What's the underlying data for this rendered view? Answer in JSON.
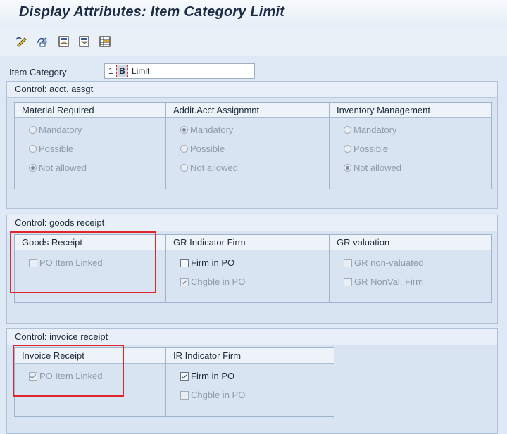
{
  "window": {
    "title": "Display Attributes: Item Category Limit"
  },
  "toolbar": {
    "buttons": [
      {
        "icon": "edit-pencil-icon"
      },
      {
        "icon": "other-object-icon"
      },
      {
        "icon": "previous-entry-icon"
      },
      {
        "icon": "next-entry-icon"
      },
      {
        "icon": "table-view-icon"
      }
    ]
  },
  "item_category": {
    "label": "Item Category",
    "code_1": "1",
    "code_2": "B",
    "description": "Limit"
  },
  "acct_assgt": {
    "title": "Control: acct. assgt",
    "groups": [
      {
        "header": "Material Required",
        "options": [
          {
            "label": "Mandatory",
            "selected": false
          },
          {
            "label": "Possible",
            "selected": false
          },
          {
            "label": "Not allowed",
            "selected": true
          }
        ]
      },
      {
        "header": "Addit.Acct Assignmnt",
        "options": [
          {
            "label": "Mandatory",
            "selected": true
          },
          {
            "label": "Possible",
            "selected": false
          },
          {
            "label": "Not allowed",
            "selected": false
          }
        ]
      },
      {
        "header": "Inventory Management",
        "options": [
          {
            "label": "Mandatory",
            "selected": false
          },
          {
            "label": "Possible",
            "selected": false
          },
          {
            "label": "Not allowed",
            "selected": true
          }
        ]
      }
    ]
  },
  "goods_receipt": {
    "title": "Control: goods receipt",
    "groups": [
      {
        "header": "Goods Receipt",
        "options": [
          {
            "label": "PO Item Linked",
            "checked": false
          }
        ]
      },
      {
        "header": "GR Indicator Firm",
        "options": [
          {
            "label": "Firm in PO",
            "checked": false
          },
          {
            "label": "Chgble in PO",
            "checked": true
          }
        ]
      },
      {
        "header": "GR valuation",
        "options": [
          {
            "label": "GR non-valuated",
            "checked": false
          },
          {
            "label": "GR NonVal. Firm",
            "checked": false
          }
        ]
      }
    ]
  },
  "invoice_receipt": {
    "title": "Control: invoice receipt",
    "groups": [
      {
        "header": "Invoice Receipt",
        "options": [
          {
            "label": "PO Item Linked",
            "checked": true
          }
        ]
      },
      {
        "header": "IR Indicator Firm",
        "options": [
          {
            "label": "Firm in PO",
            "checked": true
          },
          {
            "label": "Chgble in PO",
            "checked": false
          }
        ]
      }
    ]
  },
  "colors": {
    "highlight": "#e0262b",
    "background": "#dfe9f5"
  }
}
